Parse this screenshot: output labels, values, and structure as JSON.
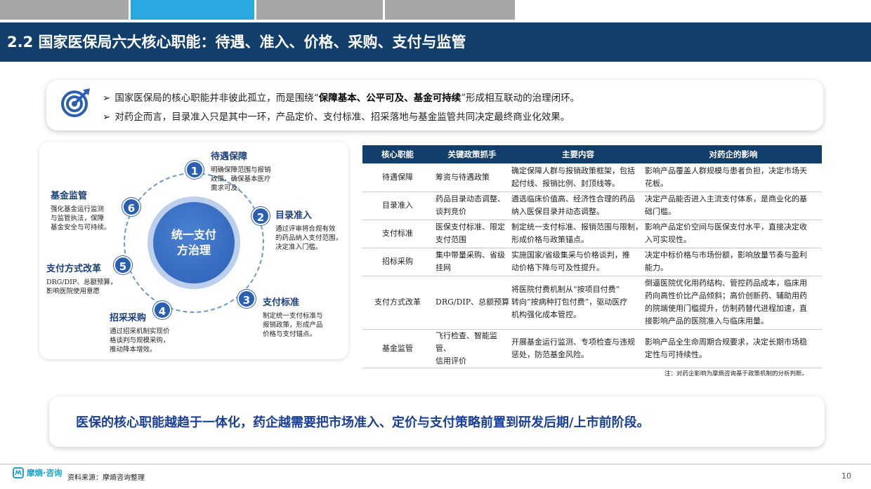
{
  "tabs": [
    {
      "active": false
    },
    {
      "active": true
    },
    {
      "active": false
    },
    {
      "active": false
    }
  ],
  "title": "2.2 国家医保局六大核心职能：待遇、准入、价格、采购、支付与监管",
  "summary": {
    "bullet1_pre": "国家医保局的核心职能并非彼此孤立，而是围绕“",
    "bullet1_bold": "保障基本、公平可及、基金可持续",
    "bullet1_post": "”形成相互联动的治理闭环。",
    "bullet2": "对药企而言，目录准入只是其中一环，产品定价、支付标准、招采落地与基金监管共同决定最终商业化效果。",
    "arrow": "➢"
  },
  "diagram": {
    "core_line1": "统一支付",
    "core_line2": "方治理",
    "nodes": [
      {
        "num": "1",
        "title": "待遇保障",
        "desc": [
          "明确保障范围与报销",
          "政策，确保基本医疗",
          "需求可及。"
        ]
      },
      {
        "num": "2",
        "title": "目录准入",
        "desc": [
          "通过评审将合规有效",
          "的药品纳入支付范围，",
          "决定准入门槛。"
        ]
      },
      {
        "num": "3",
        "title": "支付标准",
        "desc": [
          "制定统一支付标准与",
          "报销政策，形成产品",
          "价格与支付锚点。"
        ]
      },
      {
        "num": "4",
        "title": "招采采购",
        "desc": [
          "通过招采机制实现价",
          "格谈判与规模采购，",
          "推动降本增效。"
        ]
      },
      {
        "num": "5",
        "title": "支付方式改革",
        "desc": [
          "DRG/DIP、总额预算，",
          "影响医院使用意愿"
        ]
      },
      {
        "num": "6",
        "title": "基金监管",
        "desc": [
          "强化基金运行监测",
          "与监管执法，保障",
          "基金安全与可持续。"
        ]
      }
    ]
  },
  "table": {
    "headers": [
      "核心职能",
      "关键政策抓手",
      "主要内容",
      "对药企的影响"
    ],
    "rows": [
      {
        "role": "待遇保障",
        "tools": [
          "筹资与待遇政策"
        ],
        "content": [
          "确定保障人群与报销政策框架，包括",
          "起付线、报销比例、封顶线等。"
        ],
        "impact": [
          "影响产品覆盖人群规模与患者负担，决定市场天",
          "花板。"
        ]
      },
      {
        "role": "目录准入",
        "tools": [
          "药品目录动态调整、",
          "谈判竞价"
        ],
        "content": [
          "遴选临床价值高、经济性合理的药品",
          "纳入医保目录并动态调整。"
        ],
        "impact": [
          "决定产品能否进入主流支付体系，是商业化的基",
          "础门槛。"
        ]
      },
      {
        "role": "支付标准",
        "tools": [
          "医保支付标准、限定",
          "支付范围"
        ],
        "content": [
          "制定统一支付标准、报销范围与限制，",
          "形成价格与政策锚点。"
        ],
        "impact": [
          "影响产品定价空间与医保支付水平，直接决定收",
          "入可实现性。"
        ]
      },
      {
        "role": "招标采购",
        "tools": [
          "集中带量采购、省级",
          "挂网"
        ],
        "content": [
          "实施国家/省级集采与价格谈判，推",
          "动价格下降与可及性提升。"
        ],
        "impact": [
          "决定中标价格与市场份额，影响放量节奏与盈利",
          "能力。"
        ]
      },
      {
        "role": "支付方式改革",
        "tools": [
          "DRG/DIP、总额预算"
        ],
        "content": [
          "将医院付费机制从“按项目付费”",
          "转向“按病种打包付费”，驱动医疗",
          "机构强化成本管控。"
        ],
        "impact": [
          "倒逼医院优化用药结构、管控药品成本，临床用",
          "药向高性价比产品倾斜；高价创新药、辅助用药",
          "的院端使用门槛提升，仿制药替代进程加速，直",
          "接影响产品的医院准入与临床用量。"
        ]
      },
      {
        "role": "基金监管",
        "tools": [
          "飞行检查、智能监管、",
          "信用评价"
        ],
        "content": [
          "开展基金运行监测、专项检查与违规",
          "惩处，防范基金风险。"
        ],
        "impact": [
          "影响产品全生命周期合规要求，决定长期市场稳",
          "定性与可持续性。"
        ]
      }
    ],
    "note": "注：对药企影响为摩熵咨询基于政策机制的分析判断。"
  },
  "conclusion": "医保的核心职能越趋于一体化，药企越需要把市场准入、定价与支付策略前置到研发后期/上市前阶段。",
  "footer": {
    "logo": "摩熵·咨询",
    "source": "资料来源：摩熵咨询整理",
    "page": "10"
  },
  "colors": {
    "title_bar": "#123e6b",
    "active_tab": "#2aa8e0",
    "inactive_tab": "#a6a6a6",
    "node_blue": "#2b5fb3",
    "conclusion_text": "#1a3f99"
  }
}
